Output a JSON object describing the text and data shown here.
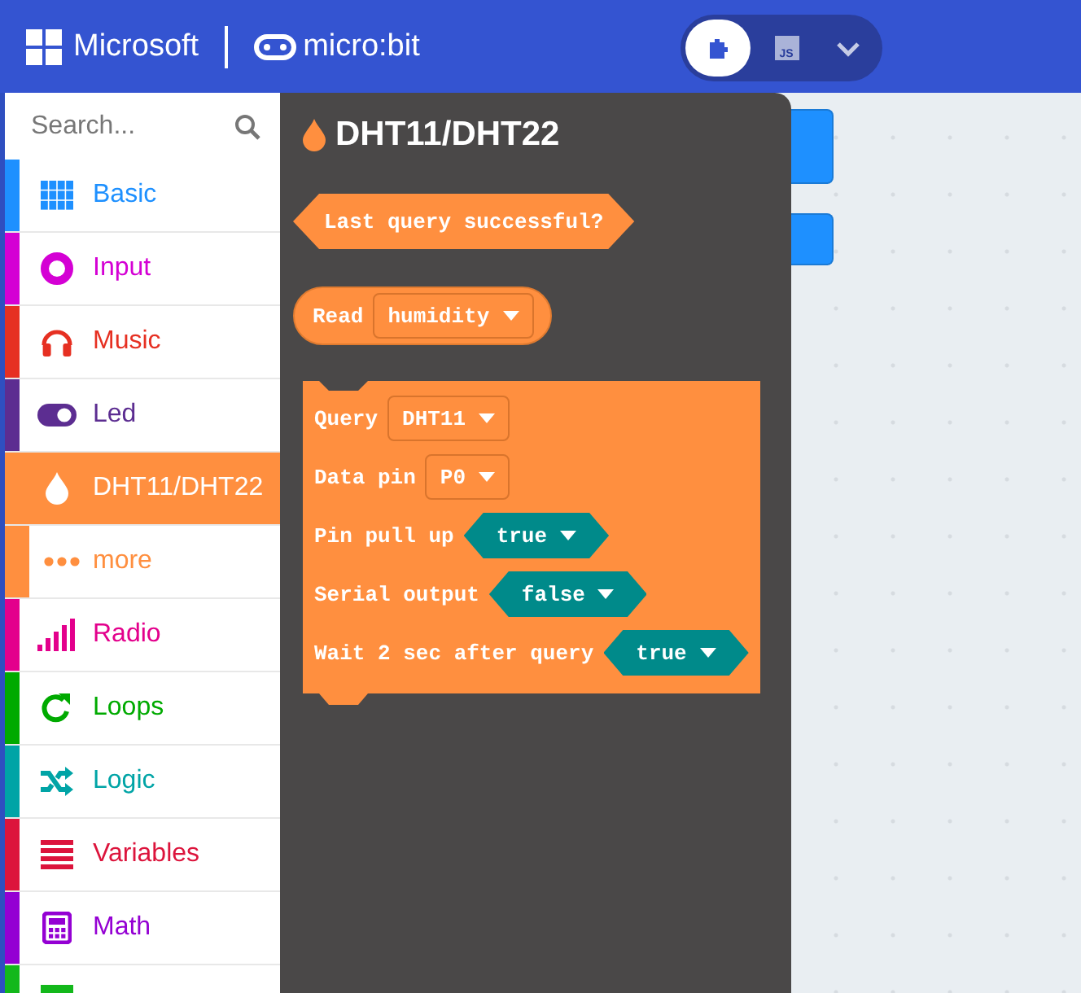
{
  "header": {
    "brand": "Microsoft",
    "product": "micro:bit",
    "editor_toggle": [
      {
        "kind": "blocks",
        "selected": true
      },
      {
        "kind": "javascript",
        "selected": false,
        "label": "JS"
      }
    ]
  },
  "toolbox": {
    "search": {
      "placeholder": "Search..."
    },
    "categories": [
      {
        "label": "Basic",
        "kind": "grid",
        "color": "#1e90ff",
        "selected": false,
        "sub": false
      },
      {
        "label": "Input",
        "kind": "target",
        "color": "#d400d4",
        "selected": false,
        "sub": false
      },
      {
        "label": "Music",
        "kind": "headphones",
        "color": "#e63022",
        "selected": false,
        "sub": false
      },
      {
        "label": "Led",
        "kind": "toggle",
        "color": "#5c2d91",
        "selected": false,
        "sub": false
      },
      {
        "label": "DHT11/DHT22",
        "kind": "drop",
        "color": "#ff8f3f",
        "selected": true,
        "sub": false
      },
      {
        "label": "more",
        "kind": "dots",
        "color": "#ff8f3f",
        "selected": false,
        "sub": true
      },
      {
        "label": "Radio",
        "kind": "bars",
        "color": "#e3008c",
        "selected": false,
        "sub": false
      },
      {
        "label": "Loops",
        "kind": "loop",
        "color": "#00aa00",
        "selected": false,
        "sub": false
      },
      {
        "label": "Logic",
        "kind": "shuffle",
        "color": "#00a4a6",
        "selected": false,
        "sub": false
      },
      {
        "label": "Variables",
        "kind": "lines",
        "color": "#dc143c",
        "selected": false,
        "sub": false
      },
      {
        "label": "Math",
        "kind": "calc",
        "color": "#9400d3",
        "selected": false,
        "sub": false
      },
      {
        "kind": "square",
        "color": "#13b81b",
        "selected": false,
        "sub": false
      }
    ]
  },
  "flyout": {
    "title": "DHT11/DHT22",
    "blocks": [
      {
        "kind": "boolean",
        "label": "Last query successful?"
      },
      {
        "kind": "reporter",
        "label": "Read",
        "dropdown": "humidity"
      },
      {
        "kind": "statement",
        "rows": [
          {
            "label": "Query",
            "field": {
              "kind": "dropdown",
              "value": "DHT11"
            }
          },
          {
            "label": "Data pin",
            "field": {
              "kind": "dropdown",
              "value": "P0"
            }
          },
          {
            "label": "Pin pull up",
            "field": {
              "kind": "boolean",
              "value": "true"
            }
          },
          {
            "label": "Serial output",
            "field": {
              "kind": "boolean",
              "value": "false"
            }
          },
          {
            "label": "Wait 2 sec after query",
            "field": {
              "kind": "boolean",
              "value": "true"
            }
          }
        ]
      }
    ]
  }
}
